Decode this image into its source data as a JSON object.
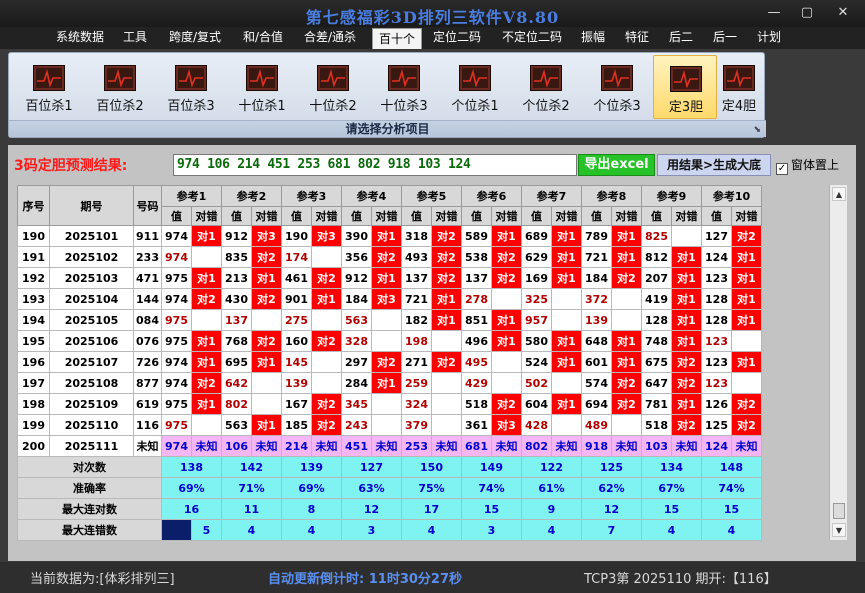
{
  "window": {
    "title": "第七感福彩3D排列三软件V8.80",
    "minimize": "—",
    "restore": "▢",
    "close": "✕"
  },
  "menu": [
    "系统数据",
    "工具",
    "跨度/复式",
    "和/合值",
    "合差/通杀",
    "百十个",
    "定位二码",
    "不定位二码",
    "振幅",
    "特征",
    "后二",
    "后一",
    "计划"
  ],
  "ribbon": {
    "buttons": [
      "百位杀1",
      "百位杀2",
      "百位杀3",
      "十位杀1",
      "十位杀2",
      "十位杀3",
      "个位杀1",
      "个位杀2",
      "个位杀3",
      "定3胆",
      "定4胆"
    ],
    "caption": "请选择分析项目"
  },
  "prediction": {
    "label": "3码定胆预测结果:",
    "value": "974 106 214 451 253 681 802 918 103 124",
    "excel_button": "导出excel",
    "generate_button": "用结果>生成大底",
    "topmost_label": "窗体置上",
    "topmost_checked": "✓"
  },
  "grid": {
    "headers": {
      "seq": "序号",
      "period": "期号",
      "number": "号码",
      "value": "值",
      "result": "对错"
    },
    "refs": [
      "参考1",
      "参考2",
      "参考3",
      "参考4",
      "参考5",
      "参考6",
      "参考7",
      "参考8",
      "参考9",
      "参考10"
    ],
    "rows": [
      {
        "seq": "190",
        "period": "2025101",
        "num": "911",
        "cells": [
          [
            "974",
            "对1"
          ],
          [
            "912",
            "对3"
          ],
          [
            "190",
            "对3"
          ],
          [
            "390",
            "对1"
          ],
          [
            "318",
            "对2"
          ],
          [
            "589",
            "对1"
          ],
          [
            "689",
            "对1"
          ],
          [
            "789",
            "对1"
          ],
          [
            "825",
            ""
          ],
          [
            "127",
            "对2"
          ]
        ]
      },
      {
        "seq": "191",
        "period": "2025102",
        "num": "233",
        "cells": [
          [
            "974",
            ""
          ],
          [
            "835",
            "对2"
          ],
          [
            "174",
            ""
          ],
          [
            "356",
            "对2"
          ],
          [
            "493",
            "对2"
          ],
          [
            "538",
            "对2"
          ],
          [
            "629",
            "对1"
          ],
          [
            "721",
            "对1"
          ],
          [
            "812",
            "对1"
          ],
          [
            "124",
            "对1"
          ]
        ]
      },
      {
        "seq": "192",
        "period": "2025103",
        "num": "471",
        "cells": [
          [
            "975",
            "对1"
          ],
          [
            "213",
            "对1"
          ],
          [
            "461",
            "对2"
          ],
          [
            "912",
            "对1"
          ],
          [
            "137",
            "对2"
          ],
          [
            "137",
            "对2"
          ],
          [
            "169",
            "对1"
          ],
          [
            "184",
            "对2"
          ],
          [
            "207",
            "对1"
          ],
          [
            "123",
            "对1"
          ]
        ]
      },
      {
        "seq": "193",
        "period": "2025104",
        "num": "144",
        "cells": [
          [
            "974",
            "对2"
          ],
          [
            "430",
            "对2"
          ],
          [
            "901",
            "对1"
          ],
          [
            "184",
            "对3"
          ],
          [
            "721",
            "对1"
          ],
          [
            "278",
            ""
          ],
          [
            "325",
            ""
          ],
          [
            "372",
            ""
          ],
          [
            "419",
            "对1"
          ],
          [
            "128",
            "对1"
          ]
        ]
      },
      {
        "seq": "194",
        "period": "2025105",
        "num": "084",
        "cells": [
          [
            "975",
            ""
          ],
          [
            "137",
            ""
          ],
          [
            "275",
            ""
          ],
          [
            "563",
            ""
          ],
          [
            "182",
            "对1"
          ],
          [
            "851",
            "对1"
          ],
          [
            "957",
            ""
          ],
          [
            "139",
            ""
          ],
          [
            "128",
            "对1"
          ],
          [
            "128",
            "对1"
          ]
        ]
      },
      {
        "seq": "195",
        "period": "2025106",
        "num": "076",
        "cells": [
          [
            "975",
            "对1"
          ],
          [
            "768",
            "对2"
          ],
          [
            "160",
            "对2"
          ],
          [
            "328",
            ""
          ],
          [
            "198",
            ""
          ],
          [
            "496",
            "对1"
          ],
          [
            "580",
            "对1"
          ],
          [
            "648",
            "对1"
          ],
          [
            "748",
            "对1"
          ],
          [
            "123",
            ""
          ]
        ]
      },
      {
        "seq": "196",
        "period": "2025107",
        "num": "726",
        "cells": [
          [
            "974",
            "对1"
          ],
          [
            "695",
            "对1"
          ],
          [
            "145",
            ""
          ],
          [
            "297",
            "对2"
          ],
          [
            "271",
            "对2"
          ],
          [
            "495",
            ""
          ],
          [
            "524",
            "对1"
          ],
          [
            "601",
            "对1"
          ],
          [
            "675",
            "对2"
          ],
          [
            "123",
            "对1"
          ]
        ]
      },
      {
        "seq": "197",
        "period": "2025108",
        "num": "877",
        "cells": [
          [
            "974",
            "对2"
          ],
          [
            "642",
            ""
          ],
          [
            "139",
            ""
          ],
          [
            "284",
            "对1"
          ],
          [
            "259",
            ""
          ],
          [
            "429",
            ""
          ],
          [
            "502",
            ""
          ],
          [
            "574",
            "对2"
          ],
          [
            "647",
            "对2"
          ],
          [
            "123",
            ""
          ]
        ]
      },
      {
        "seq": "198",
        "period": "2025109",
        "num": "619",
        "cells": [
          [
            "975",
            "对1"
          ],
          [
            "802",
            ""
          ],
          [
            "167",
            "对2"
          ],
          [
            "345",
            ""
          ],
          [
            "324",
            ""
          ],
          [
            "518",
            "对2"
          ],
          [
            "604",
            "对1"
          ],
          [
            "694",
            "对2"
          ],
          [
            "781",
            "对1"
          ],
          [
            "126",
            "对2"
          ]
        ]
      },
      {
        "seq": "199",
        "period": "2025110",
        "num": "116",
        "cells": [
          [
            "975",
            ""
          ],
          [
            "563",
            "对1"
          ],
          [
            "185",
            "对2"
          ],
          [
            "243",
            ""
          ],
          [
            "379",
            ""
          ],
          [
            "361",
            "对3"
          ],
          [
            "428",
            ""
          ],
          [
            "489",
            ""
          ],
          [
            "518",
            "对2"
          ],
          [
            "125",
            "对2"
          ]
        ]
      }
    ],
    "pending": {
      "seq": "200",
      "period": "2025111",
      "num": "未知",
      "values": [
        "974",
        "106",
        "214",
        "451",
        "253",
        "681",
        "802",
        "918",
        "103",
        "124"
      ],
      "result": "未知"
    },
    "stats": [
      {
        "label": "对次数",
        "values": [
          "138",
          "142",
          "139",
          "127",
          "150",
          "149",
          "122",
          "125",
          "134",
          "148"
        ]
      },
      {
        "label": "准确率",
        "values": [
          "69%",
          "71%",
          "69%",
          "63%",
          "75%",
          "74%",
          "61%",
          "62%",
          "67%",
          "74%"
        ]
      },
      {
        "label": "最大连对数",
        "values": [
          "16",
          "11",
          "8",
          "12",
          "17",
          "15",
          "9",
          "12",
          "15",
          "15"
        ]
      },
      {
        "label": "最大连错数",
        "values": [
          "5",
          "4",
          "4",
          "3",
          "4",
          "3",
          "4",
          "7",
          "4",
          "4"
        ]
      }
    ]
  },
  "status": {
    "source": "当前数据为:[体彩排列三]",
    "countdown": "自动更新倒计时: 11时30分27秒",
    "latest": "TCP3第 2025110 期开:【116】"
  },
  "colors": {
    "hit": "#ff0000",
    "miss_text": "#b00000",
    "stat_bg": "#7ff2f2",
    "pending_bg": "#f4b6f4",
    "accent_title": "#4a7de0"
  }
}
